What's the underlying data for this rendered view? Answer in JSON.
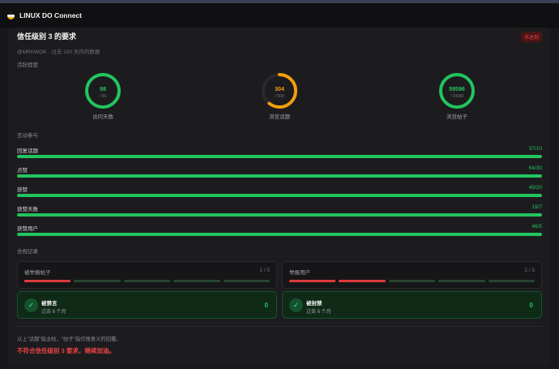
{
  "app": {
    "title": "LINUX DO Connect",
    "logo_colors": [
      "#1c1c1c",
      "#f0f0f0",
      "#f5b400"
    ]
  },
  "header": {
    "title": "信任级别 3 的要求",
    "badge": "未达到",
    "subtitle": "@MRKWOK · 过去 100 天内的数据"
  },
  "activity": {
    "section_label": "活跃程度",
    "rings": [
      {
        "value": "98",
        "target": "/ 50",
        "label": "访问天数",
        "progress": 1.0,
        "color": "#22c55e"
      },
      {
        "value": "304",
        "target": "/ 500",
        "label": "浏览话题",
        "progress": 0.608,
        "color": "#f59e0b"
      },
      {
        "value": "59596",
        "target": "/ 20000",
        "label": "浏览帖子",
        "progress": 1.0,
        "color": "#22c55e"
      }
    ]
  },
  "interaction": {
    "section_label": "互动参与",
    "bars": [
      {
        "name": "回复话题",
        "value": "37/10",
        "progress": 1.0
      },
      {
        "name": "点赞",
        "value": "64/30",
        "progress": 1.0
      },
      {
        "name": "获赞",
        "value": "49/20",
        "progress": 1.0
      },
      {
        "name": "获赞天数",
        "value": "19/7",
        "progress": 1.0
      },
      {
        "name": "获赞用户",
        "value": "46/5",
        "progress": 1.0
      }
    ]
  },
  "compliance": {
    "section_label": "合规记录",
    "cards": [
      {
        "title": "被举报帖子",
        "count": "1 / 5",
        "filled": 1,
        "total": 5
      },
      {
        "title": "举报用户",
        "count": "2 / 5",
        "filled": 2,
        "total": 5
      }
    ],
    "status_cards": [
      {
        "title": "被禁言",
        "sub": "过去 6 个月",
        "value": "0"
      },
      {
        "title": "被封禁",
        "sub": "过去 6 个月",
        "value": "0"
      }
    ]
  },
  "footer": {
    "note": "以上\"话题\"指主帖，\"帖子\"指作惟意义的回覆。",
    "message": "不符合信任级别 3 要求，继续加油。"
  },
  "colors": {
    "success": "#22c55e",
    "warning": "#f59e0b",
    "danger": "#ef4444",
    "segment_filled": "#dc3b3b",
    "segment_empty": "#26452f"
  }
}
